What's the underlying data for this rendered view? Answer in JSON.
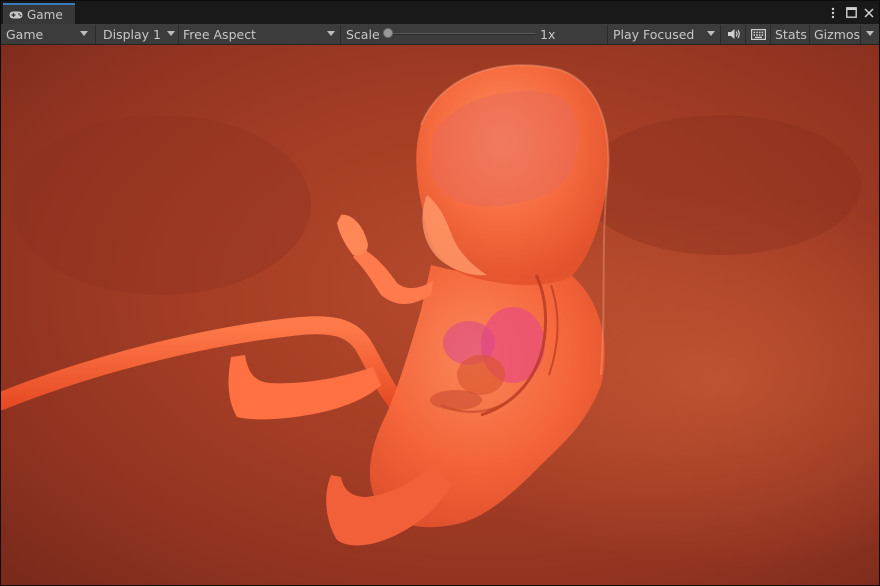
{
  "window": {
    "tab_label": "Game",
    "tab_icon": "gamepad-icon",
    "controls": [
      "kebab-menu-icon",
      "maximize-icon",
      "close-icon"
    ]
  },
  "toolbar": {
    "mode_dropdown": "Game",
    "display_dropdown": "Display 1",
    "aspect_dropdown": "Free Aspect",
    "scale_label": "Scale",
    "scale_value": "1x",
    "scale_level": 0,
    "play_mode_dropdown": "Play Focused",
    "mute_icon": "speaker-icon",
    "keyboard_icon": "keyboard-icon",
    "stats_label": "Stats",
    "gizmos_label": "Gizmos"
  },
  "colors": {
    "accent_tab": "#3a79bb",
    "toolbar_bg": "#3c3c3c",
    "chrome_bg": "#191919",
    "scene_bg": "#9a3a24",
    "embryo_body": "#ff6a3d"
  }
}
